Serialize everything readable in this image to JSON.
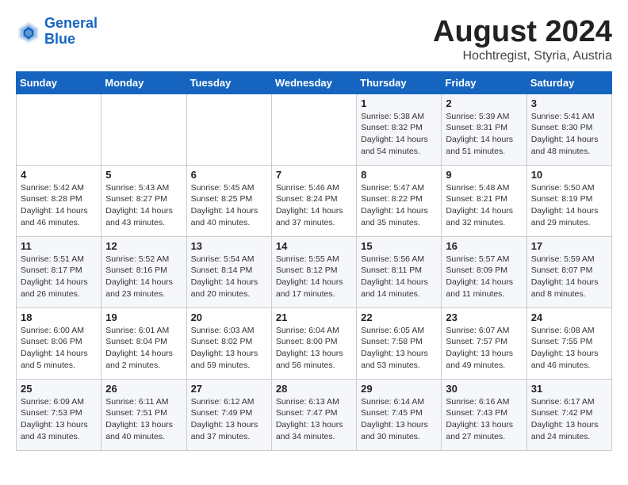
{
  "logo": {
    "line1": "General",
    "line2": "Blue"
  },
  "title": {
    "month_year": "August 2024",
    "subtitle": "Hochtregist, Styria, Austria"
  },
  "header": {
    "days": [
      "Sunday",
      "Monday",
      "Tuesday",
      "Wednesday",
      "Thursday",
      "Friday",
      "Saturday"
    ]
  },
  "weeks": [
    {
      "cells": [
        {
          "day": "",
          "info": ""
        },
        {
          "day": "",
          "info": ""
        },
        {
          "day": "",
          "info": ""
        },
        {
          "day": "",
          "info": ""
        },
        {
          "day": "1",
          "info": "Sunrise: 5:38 AM\nSunset: 8:32 PM\nDaylight: 14 hours\nand 54 minutes."
        },
        {
          "day": "2",
          "info": "Sunrise: 5:39 AM\nSunset: 8:31 PM\nDaylight: 14 hours\nand 51 minutes."
        },
        {
          "day": "3",
          "info": "Sunrise: 5:41 AM\nSunset: 8:30 PM\nDaylight: 14 hours\nand 48 minutes."
        }
      ]
    },
    {
      "cells": [
        {
          "day": "4",
          "info": "Sunrise: 5:42 AM\nSunset: 8:28 PM\nDaylight: 14 hours\nand 46 minutes."
        },
        {
          "day": "5",
          "info": "Sunrise: 5:43 AM\nSunset: 8:27 PM\nDaylight: 14 hours\nand 43 minutes."
        },
        {
          "day": "6",
          "info": "Sunrise: 5:45 AM\nSunset: 8:25 PM\nDaylight: 14 hours\nand 40 minutes."
        },
        {
          "day": "7",
          "info": "Sunrise: 5:46 AM\nSunset: 8:24 PM\nDaylight: 14 hours\nand 37 minutes."
        },
        {
          "day": "8",
          "info": "Sunrise: 5:47 AM\nSunset: 8:22 PM\nDaylight: 14 hours\nand 35 minutes."
        },
        {
          "day": "9",
          "info": "Sunrise: 5:48 AM\nSunset: 8:21 PM\nDaylight: 14 hours\nand 32 minutes."
        },
        {
          "day": "10",
          "info": "Sunrise: 5:50 AM\nSunset: 8:19 PM\nDaylight: 14 hours\nand 29 minutes."
        }
      ]
    },
    {
      "cells": [
        {
          "day": "11",
          "info": "Sunrise: 5:51 AM\nSunset: 8:17 PM\nDaylight: 14 hours\nand 26 minutes."
        },
        {
          "day": "12",
          "info": "Sunrise: 5:52 AM\nSunset: 8:16 PM\nDaylight: 14 hours\nand 23 minutes."
        },
        {
          "day": "13",
          "info": "Sunrise: 5:54 AM\nSunset: 8:14 PM\nDaylight: 14 hours\nand 20 minutes."
        },
        {
          "day": "14",
          "info": "Sunrise: 5:55 AM\nSunset: 8:12 PM\nDaylight: 14 hours\nand 17 minutes."
        },
        {
          "day": "15",
          "info": "Sunrise: 5:56 AM\nSunset: 8:11 PM\nDaylight: 14 hours\nand 14 minutes."
        },
        {
          "day": "16",
          "info": "Sunrise: 5:57 AM\nSunset: 8:09 PM\nDaylight: 14 hours\nand 11 minutes."
        },
        {
          "day": "17",
          "info": "Sunrise: 5:59 AM\nSunset: 8:07 PM\nDaylight: 14 hours\nand 8 minutes."
        }
      ]
    },
    {
      "cells": [
        {
          "day": "18",
          "info": "Sunrise: 6:00 AM\nSunset: 8:06 PM\nDaylight: 14 hours\nand 5 minutes."
        },
        {
          "day": "19",
          "info": "Sunrise: 6:01 AM\nSunset: 8:04 PM\nDaylight: 14 hours\nand 2 minutes."
        },
        {
          "day": "20",
          "info": "Sunrise: 6:03 AM\nSunset: 8:02 PM\nDaylight: 13 hours\nand 59 minutes."
        },
        {
          "day": "21",
          "info": "Sunrise: 6:04 AM\nSunset: 8:00 PM\nDaylight: 13 hours\nand 56 minutes."
        },
        {
          "day": "22",
          "info": "Sunrise: 6:05 AM\nSunset: 7:58 PM\nDaylight: 13 hours\nand 53 minutes."
        },
        {
          "day": "23",
          "info": "Sunrise: 6:07 AM\nSunset: 7:57 PM\nDaylight: 13 hours\nand 49 minutes."
        },
        {
          "day": "24",
          "info": "Sunrise: 6:08 AM\nSunset: 7:55 PM\nDaylight: 13 hours\nand 46 minutes."
        }
      ]
    },
    {
      "cells": [
        {
          "day": "25",
          "info": "Sunrise: 6:09 AM\nSunset: 7:53 PM\nDaylight: 13 hours\nand 43 minutes."
        },
        {
          "day": "26",
          "info": "Sunrise: 6:11 AM\nSunset: 7:51 PM\nDaylight: 13 hours\nand 40 minutes."
        },
        {
          "day": "27",
          "info": "Sunrise: 6:12 AM\nSunset: 7:49 PM\nDaylight: 13 hours\nand 37 minutes."
        },
        {
          "day": "28",
          "info": "Sunrise: 6:13 AM\nSunset: 7:47 PM\nDaylight: 13 hours\nand 34 minutes."
        },
        {
          "day": "29",
          "info": "Sunrise: 6:14 AM\nSunset: 7:45 PM\nDaylight: 13 hours\nand 30 minutes."
        },
        {
          "day": "30",
          "info": "Sunrise: 6:16 AM\nSunset: 7:43 PM\nDaylight: 13 hours\nand 27 minutes."
        },
        {
          "day": "31",
          "info": "Sunrise: 6:17 AM\nSunset: 7:42 PM\nDaylight: 13 hours\nand 24 minutes."
        }
      ]
    }
  ]
}
